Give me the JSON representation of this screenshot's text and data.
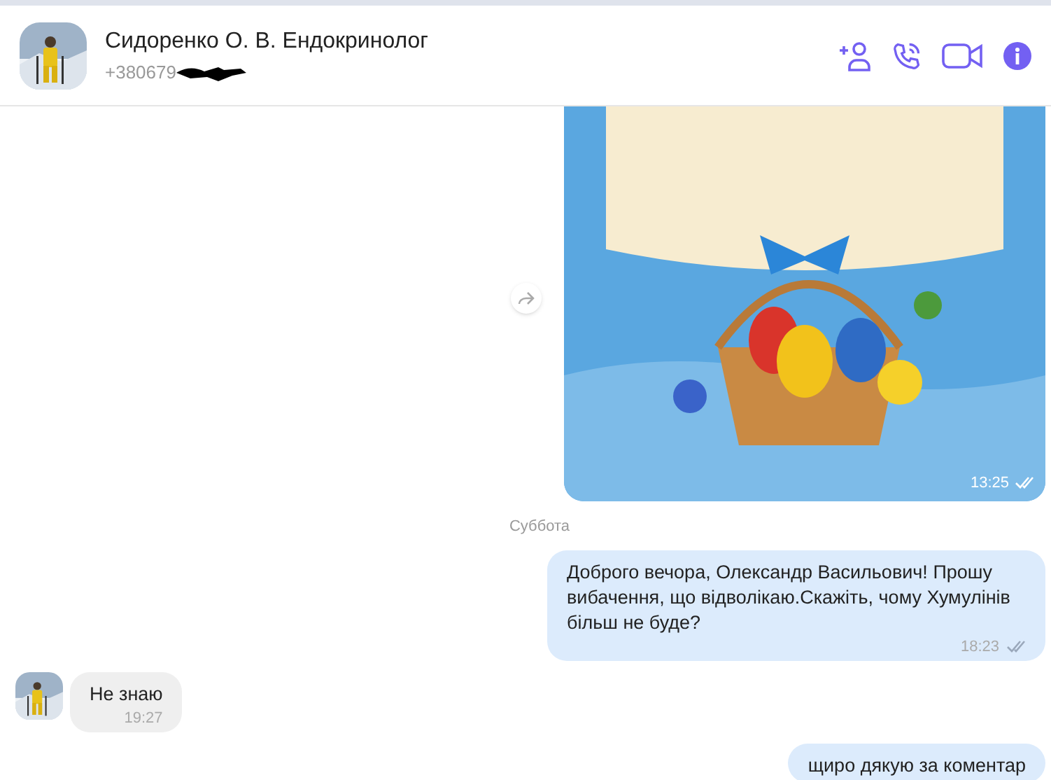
{
  "contact": {
    "name": "Сидоренко О. В. Ендокринолог",
    "phone": "+380679",
    "redacted": true
  },
  "messages": [
    {
      "kind": "picture",
      "outgoing": true,
      "time": "13:25",
      "read": true
    },
    {
      "kind": "date",
      "text": "Суббота"
    },
    {
      "kind": "text",
      "outgoing": true,
      "text": "Доброго вечора, Олександр Васильович! Прошу вибачення, що відволікаю.Скажіть, чому Хумулінів більш не буде?",
      "time": "18:23",
      "read": true
    },
    {
      "kind": "text",
      "outgoing": false,
      "text": "Не знаю",
      "time": "19:27"
    },
    {
      "kind": "text",
      "outgoing": true,
      "text": "щиро дякую за коментар"
    }
  ]
}
